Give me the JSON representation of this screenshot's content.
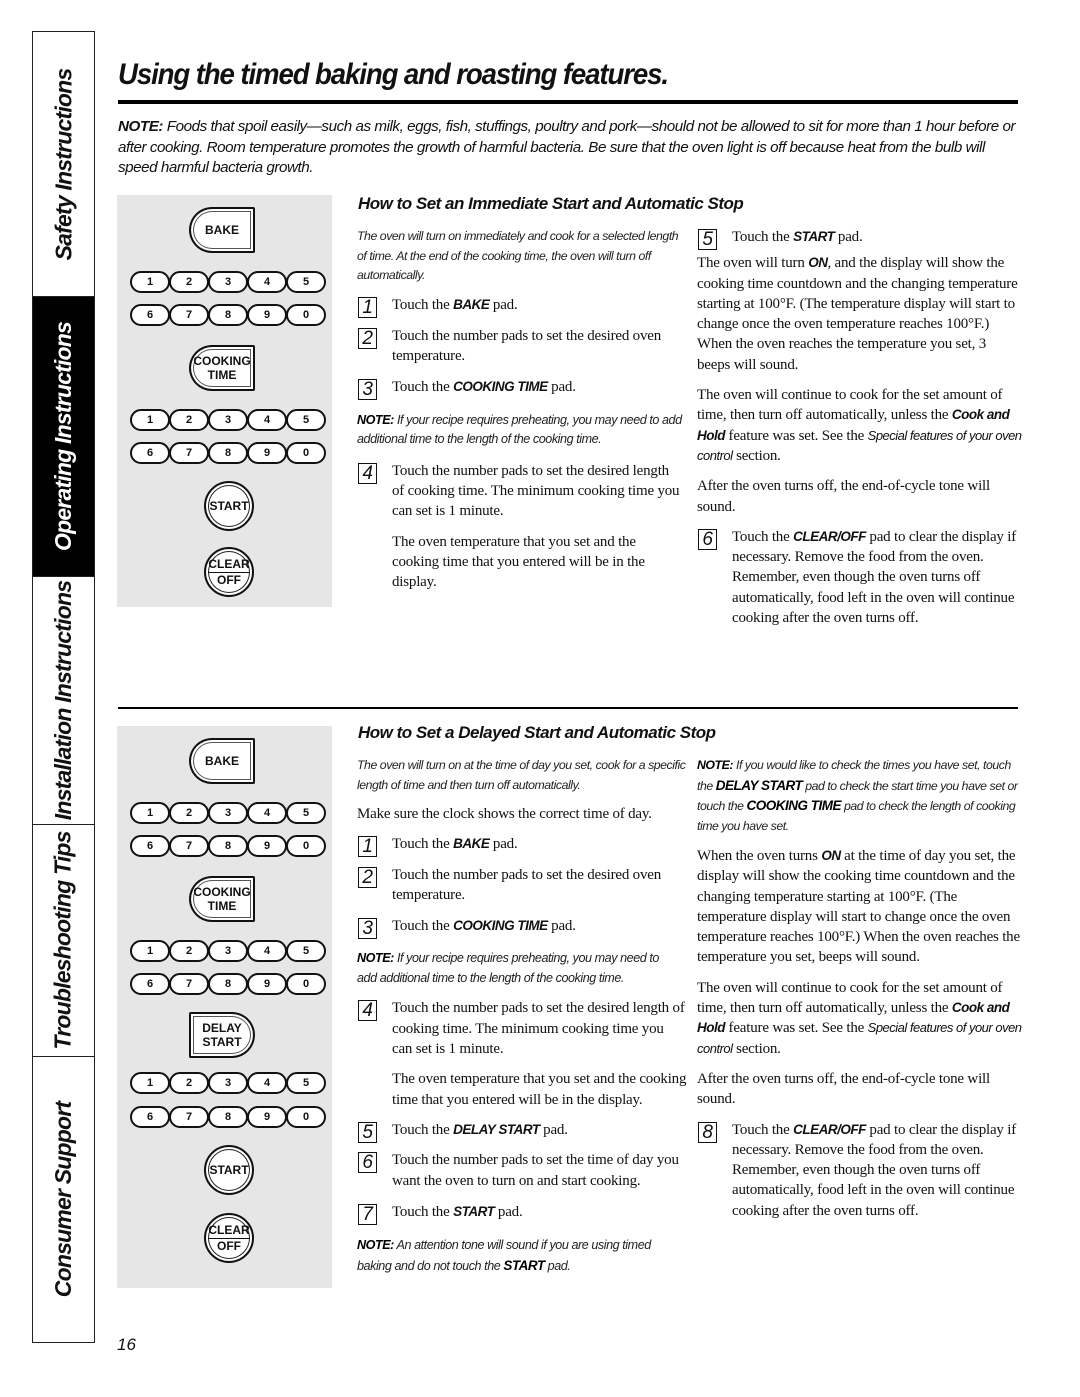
{
  "sidebar": {
    "tabs": [
      {
        "label": "Safety Instructions",
        "active": false
      },
      {
        "label": "Operating Instructions",
        "active": true
      },
      {
        "label": "Installation Instructions",
        "active": false
      },
      {
        "label": "Troubleshooting Tips",
        "active": false
      },
      {
        "label": "Consumer Support",
        "active": false
      }
    ]
  },
  "page": {
    "title": "Using the timed baking and roasting features.",
    "food_note_label": "NOTE:",
    "food_note_text": " Foods that spoil easily—such as milk, eggs, fish, stuffings, poultry and pork—should not be allowed to sit for more than 1 hour before or after cooking. Room temperature promotes the growth of harmful bacteria. Be sure that the oven light is off because heat from the bulb will speed harmful bacteria growth.",
    "page_number": "16"
  },
  "panel_labels": {
    "bake": "BAKE",
    "cooking": "COOKING",
    "time": "TIME",
    "start": "START",
    "clear": "CLEAR",
    "off": "OFF",
    "delay": "DELAY",
    "delay_start": "START",
    "digits_row1": [
      "1",
      "2",
      "3",
      "4",
      "5"
    ],
    "digits_row2": [
      "6",
      "7",
      "8",
      "9",
      "0"
    ]
  },
  "immediate": {
    "heading": "How to Set an Immediate Start and Automatic Stop",
    "intro": "The oven will turn on immediately and cook for a selected length of time. At the end of the cooking time, the oven will turn off automatically.",
    "steps": [
      {
        "num": "1",
        "pre": "Touch the ",
        "kw": "BAKE",
        "post": " pad."
      },
      {
        "num": "2",
        "text": "Touch the number pads to set the desired oven temperature."
      },
      {
        "num": "3",
        "pre": "Touch the ",
        "kw": "COOKING TIME",
        "post": " pad."
      },
      {
        "num": "4",
        "text": "Touch the number pads to set the desired length of cooking time. The minimum cooking time you can set is 1 minute."
      },
      {
        "num": "5",
        "pre": "Touch the ",
        "kw": "START",
        "post": " pad."
      },
      {
        "num": "6",
        "pre": "Touch the ",
        "kw": "CLEAR/OFF",
        "post": " pad to clear the display if necessary. Remove the food from the oven. Remember, even though the oven turns off automatically, food left in the oven will continue cooking after the oven turns off."
      }
    ],
    "note_label": "NOTE:",
    "note_text": " If your recipe requires preheating, you may need to add additional time to the length of the cooking time.",
    "step4_after": "The oven temperature that you set and the cooking time that you entered will be in the display.",
    "on_para_pre": "The oven will turn ",
    "on_kw": "ON",
    "on_para_post": ", and the display will show the cooking time countdown and the changing temperature starting at 100°F. (The temperature display will start to change once the oven temperature reaches 100°F.) When the oven reaches the temperature you set, 3 beeps will sound.",
    "continue_pre": "The oven will continue to cook for the set amount of time, then turn off automatically, unless the ",
    "continue_kw": "Cook and Hold",
    "continue_mid": " feature was set. See the ",
    "continue_ital": "Special features of your oven control",
    "continue_post": " section.",
    "tone": "After the oven turns off, the end-of-cycle tone will sound."
  },
  "delayed": {
    "heading": "How to Set a Delayed Start and Automatic Stop",
    "intro": "The oven will turn on at the time of day you set, cook for a specific length of time and then turn off automatically.",
    "clock": "Make sure the clock shows the correct time of day.",
    "steps": [
      {
        "num": "1",
        "pre": "Touch the ",
        "kw": "BAKE",
        "post": " pad."
      },
      {
        "num": "2",
        "text": "Touch the number pads to set the desired oven temperature."
      },
      {
        "num": "3",
        "pre": "Touch the ",
        "kw": "COOKING TIME",
        "post": " pad."
      },
      {
        "num": "4",
        "text": "Touch the number pads to set the desired length of cooking time. The minimum cooking time you can set is 1 minute."
      },
      {
        "num": "5",
        "pre": "Touch the ",
        "kw": "DELAY START",
        "post": " pad."
      },
      {
        "num": "6",
        "text": "Touch the number pads to set the time of day you want the oven to turn on and start cooking."
      },
      {
        "num": "7",
        "pre": "Touch the ",
        "kw": "START",
        "post": " pad."
      },
      {
        "num": "8",
        "pre": "Touch the ",
        "kw": "CLEAR/OFF",
        "post": " pad to clear the display if necessary. Remove the food from the oven. Remember, even though the oven turns off automatically, food left in the oven will continue cooking after the oven turns off."
      }
    ],
    "note1_label": "NOTE:",
    "note1_text": " If your recipe requires preheating, you may need to add additional time to the length of the cooking time.",
    "step4_after": "The oven temperature that you set and the cooking time that you entered will be in the display.",
    "note2_label": "NOTE:",
    "note2_pre": " An attention tone will sound if you are using timed baking and do not touch the ",
    "note2_kw": "START",
    "note2_post": " pad.",
    "note3_label": "NOTE:",
    "note3_pre": " If you would like to check the times you have set, touch the ",
    "note3_kw1": "DELAY START",
    "note3_mid": " pad to check the start time you have set or touch the ",
    "note3_kw2": "COOKING TIME",
    "note3_post": "  pad to check the length of cooking time you have set.",
    "on_para_pre": "When the oven turns ",
    "on_kw": "ON",
    "on_para_post": " at the time of day you set, the display will show the cooking time countdown and the changing temperature starting at 100°F. (The temperature display will start to change once the oven temperature reaches 100°F.) When the oven reaches the temperature you set, beeps will sound.",
    "continue_pre": "The oven will continue to cook for the set amount of time, then turn off automatically, unless the ",
    "continue_kw": "Cook and Hold",
    "continue_mid": " feature was set. See the ",
    "continue_ital": "Special features of your oven control",
    "continue_post": " section.",
    "tone": "After the oven turns off, the end-of-cycle tone will sound."
  }
}
